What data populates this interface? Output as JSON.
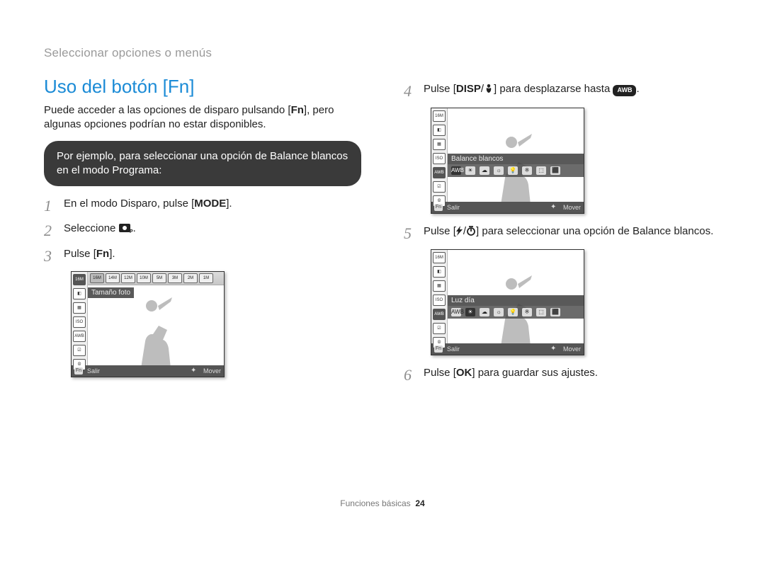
{
  "breadcrumb": "Seleccionar opciones o menús",
  "title": "Uso del botón [Fn]",
  "intro_a": "Puede acceder a las opciones de disparo pulsando [",
  "intro_key": "Fn",
  "intro_b": "], pero algunas opciones podrían no estar disponibles.",
  "callout": "Por ejemplo, para seleccionar una opción de Balance blancos en el modo Programa:",
  "steps_left": {
    "s1_a": "En el modo Disparo, pulse [",
    "s1_icon": "MODE",
    "s1_b": "].",
    "s2_a": "Seleccione ",
    "s2_icon": "Op",
    "s2_b": ".",
    "s3_a": "Pulse [",
    "s3_icon": "Fn",
    "s3_b": "]."
  },
  "steps_right": {
    "s4_a": "Pulse [",
    "s4_icon1": "DISP",
    "s4_sep": "/",
    "s4_icon2": "macro",
    "s4_b": "] para desplazarse hasta ",
    "s4_end_icon": "AWB",
    "s4_c": ".",
    "s5_a": "Pulse [",
    "s5_icon1": "flash",
    "s5_sep": "/",
    "s5_icon2": "timer",
    "s5_b": "] para seleccionar una opción de Balance blancos.",
    "s6_a": "Pulse [",
    "s6_icon": "OK",
    "s6_b": "] para guardar sus ajustes."
  },
  "screens": {
    "sidebar_icons": [
      "16M",
      "◧",
      "▦",
      "ISO",
      "AWB",
      "☑",
      "⮾"
    ],
    "screen1": {
      "toprow": [
        "16M",
        "14M",
        "12M",
        "10M",
        "5M",
        "3M",
        "2M",
        "1M"
      ],
      "label": "Tamaño foto",
      "footer": {
        "left_btn": "Fn",
        "left_label": "Salir",
        "right_label": "Mover"
      }
    },
    "screen2": {
      "label": "Balance blancos",
      "options": [
        "AWB",
        "☀",
        "☁",
        "☼",
        "💡",
        "※",
        "⬚",
        "⬛"
      ],
      "footer": {
        "left_btn": "Fn",
        "left_label": "Salir",
        "right_label": "Mover"
      }
    },
    "screen3": {
      "label": "Luz día",
      "options": [
        "AWB",
        "☀",
        "☁",
        "☼",
        "💡",
        "※",
        "⬚",
        "⬛"
      ],
      "footer": {
        "left_btn": "Fn",
        "left_label": "Salir",
        "right_label": "Mover"
      }
    }
  },
  "footer": {
    "section": "Funciones básicas",
    "page": "24"
  }
}
